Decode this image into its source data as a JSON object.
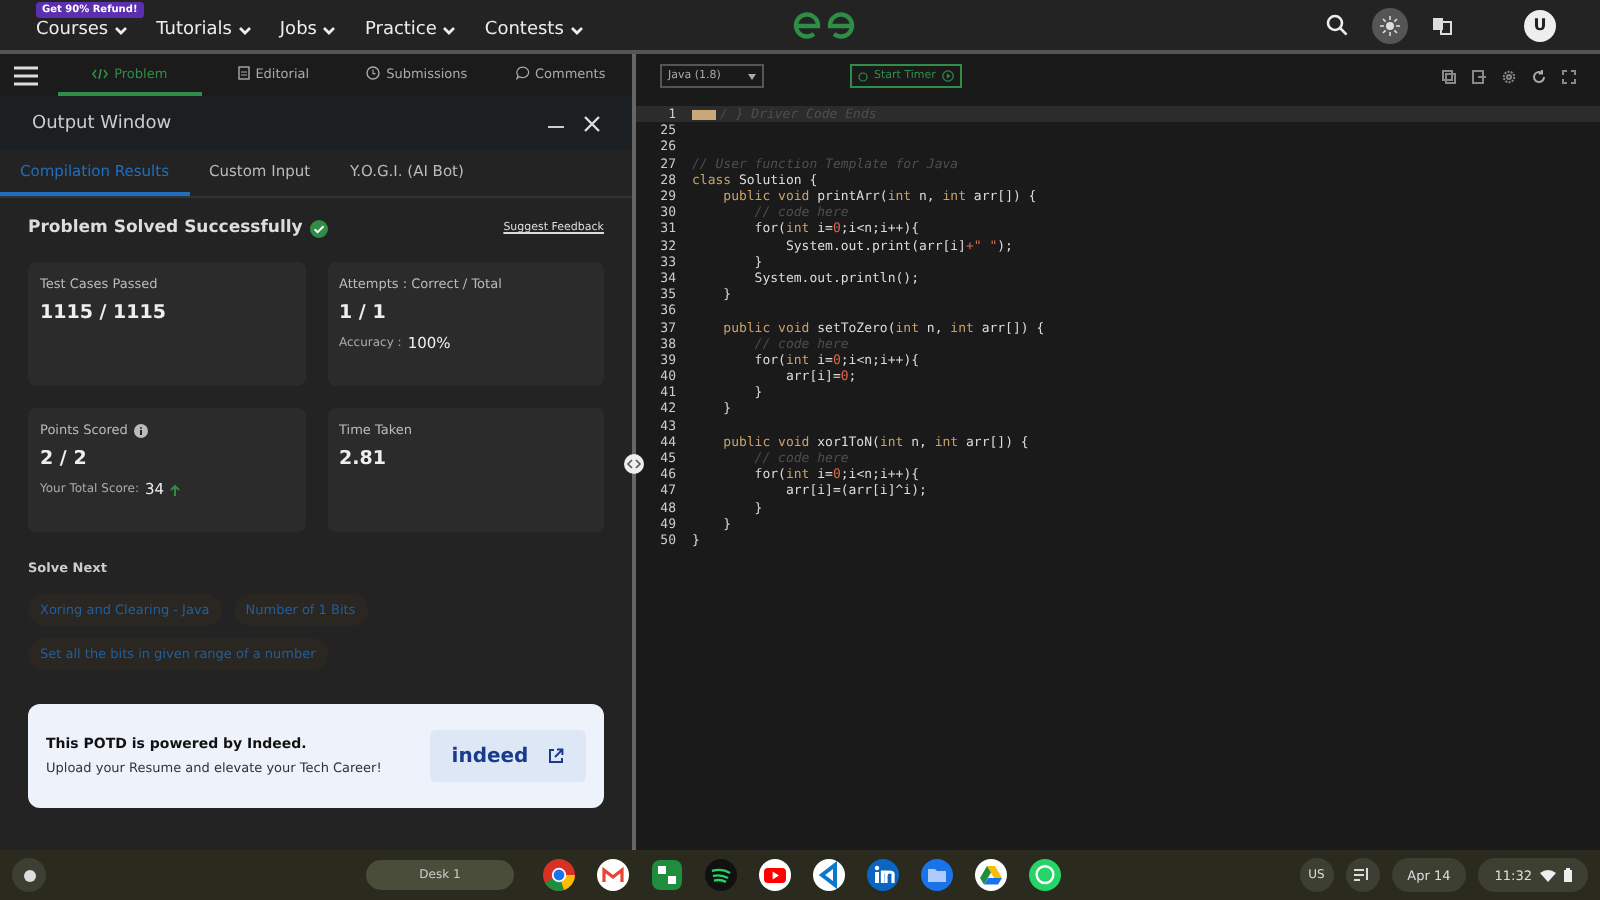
{
  "top_nav": {
    "promo_badge": "Get 90% Refund!",
    "menus": [
      "Courses",
      "Tutorials",
      "Jobs",
      "Practice",
      "Contests"
    ],
    "avatar": "U"
  },
  "problem_tabs": [
    {
      "label": "Problem",
      "selected": true
    },
    {
      "label": "Editorial",
      "selected": false
    },
    {
      "label": "Submissions",
      "selected": false
    },
    {
      "label": "Comments",
      "selected": false
    }
  ],
  "output_window": {
    "title": "Output Window",
    "tabs": [
      {
        "label": "Compilation Results",
        "selected": true
      },
      {
        "label": "Custom Input",
        "selected": false
      },
      {
        "label": "Y.O.G.I. (AI Bot)",
        "selected": false
      }
    ],
    "status": "Problem Solved Successfully",
    "feedback_link": "Suggest Feedback",
    "cards": [
      {
        "label": "Test Cases Passed",
        "value": "1115 / 1115"
      },
      {
        "label": "Attempts : Correct / Total",
        "value": "1 / 1",
        "sub_label": "Accuracy :",
        "sub_value": "100%"
      },
      {
        "label": "Points Scored",
        "value": "2 / 2",
        "info": true,
        "sub_label": "Your Total Score:",
        "sub_value": "34",
        "trend_up": true
      },
      {
        "label": "Time Taken",
        "value": "2.81"
      }
    ],
    "solve_next_title": "Solve Next",
    "solve_next": [
      "Xoring and Clearing - Java",
      "Number of 1 Bits",
      "Set all the bits in given range of a number"
    ],
    "promo": {
      "title": "This POTD is powered by Indeed.",
      "text": "Upload your Resume and elevate your Tech Career!",
      "logo": "indeed"
    }
  },
  "editor": {
    "language": "Java (1.8)",
    "timer": "Start Timer",
    "lines": [
      {
        "num": "1",
        "folded": true,
        "tokens": [
          {
            "kind": "cm",
            "text": "/ } Driver Code Ends"
          }
        ]
      },
      {
        "num": "25"
      },
      {
        "num": "26"
      },
      {
        "num": "27",
        "tokens": [
          {
            "kind": "cm",
            "text": "// User function Template for Java"
          }
        ]
      },
      {
        "num": "28",
        "tokens": [
          {
            "kind": "kw",
            "text": "class"
          },
          {
            "kind": "tx",
            "text": " Solution {"
          }
        ]
      },
      {
        "num": "29",
        "tokens": [
          {
            "kind": "kw",
            "text": "    public void"
          },
          {
            "kind": "tx",
            "text": " printArr("
          },
          {
            "kind": "kw",
            "text": "int"
          },
          {
            "kind": "tx",
            "text": " n, "
          },
          {
            "kind": "kw",
            "text": "int"
          },
          {
            "kind": "tx",
            "text": " arr[]) {"
          }
        ]
      },
      {
        "num": "30",
        "tokens": [
          {
            "kind": "cm",
            "text": "        // code here"
          }
        ]
      },
      {
        "num": "31",
        "tokens": [
          {
            "kind": "tx",
            "text": "        for("
          },
          {
            "kind": "kw",
            "text": "int"
          },
          {
            "kind": "tx",
            "text": " i="
          },
          {
            "kind": "nm",
            "text": "0"
          },
          {
            "kind": "tx",
            "text": ";i<n;i++){"
          }
        ]
      },
      {
        "num": "32",
        "tokens": [
          {
            "kind": "tx",
            "text": "            System.out.print(arr[i]"
          },
          {
            "kind": "nm",
            "text": "+\" \""
          },
          {
            "kind": "tx",
            "text": ");"
          }
        ]
      },
      {
        "num": "33",
        "tokens": [
          {
            "kind": "tx",
            "text": "        }"
          }
        ]
      },
      {
        "num": "34",
        "tokens": [
          {
            "kind": "tx",
            "text": "        System.out.println();"
          }
        ]
      },
      {
        "num": "35",
        "tokens": [
          {
            "kind": "tx",
            "text": "    }"
          }
        ]
      },
      {
        "num": "36"
      },
      {
        "num": "37",
        "tokens": [
          {
            "kind": "kw",
            "text": "    public void"
          },
          {
            "kind": "tx",
            "text": " setToZero("
          },
          {
            "kind": "kw",
            "text": "int"
          },
          {
            "kind": "tx",
            "text": " n, "
          },
          {
            "kind": "kw",
            "text": "int"
          },
          {
            "kind": "tx",
            "text": " arr[]) {"
          }
        ]
      },
      {
        "num": "38",
        "tokens": [
          {
            "kind": "cm",
            "text": "        // code here"
          }
        ]
      },
      {
        "num": "39",
        "tokens": [
          {
            "kind": "tx",
            "text": "        for("
          },
          {
            "kind": "kw",
            "text": "int"
          },
          {
            "kind": "tx",
            "text": " i="
          },
          {
            "kind": "nm",
            "text": "0"
          },
          {
            "kind": "tx",
            "text": ";i<n;i++){"
          }
        ]
      },
      {
        "num": "40",
        "tokens": [
          {
            "kind": "tx",
            "text": "            arr[i]="
          },
          {
            "kind": "nm",
            "text": "0"
          },
          {
            "kind": "tx",
            "text": ";"
          }
        ]
      },
      {
        "num": "41",
        "tokens": [
          {
            "kind": "tx",
            "text": "        }"
          }
        ]
      },
      {
        "num": "42",
        "tokens": [
          {
            "kind": "tx",
            "text": "    }"
          }
        ]
      },
      {
        "num": "43"
      },
      {
        "num": "44",
        "tokens": [
          {
            "kind": "kw",
            "text": "    public void"
          },
          {
            "kind": "tx",
            "text": " xor1ToN("
          },
          {
            "kind": "kw",
            "text": "int"
          },
          {
            "kind": "tx",
            "text": " n, "
          },
          {
            "kind": "kw",
            "text": "int"
          },
          {
            "kind": "tx",
            "text": " arr[]) {"
          }
        ]
      },
      {
        "num": "45",
        "tokens": [
          {
            "kind": "cm",
            "text": "        // code here"
          }
        ]
      },
      {
        "num": "46",
        "tokens": [
          {
            "kind": "tx",
            "text": "        for("
          },
          {
            "kind": "kw",
            "text": "int"
          },
          {
            "kind": "tx",
            "text": " i="
          },
          {
            "kind": "nm",
            "text": "0"
          },
          {
            "kind": "tx",
            "text": ";i<n;i++){"
          }
        ]
      },
      {
        "num": "47",
        "tokens": [
          {
            "kind": "tx",
            "text": "            arr[i]=(arr[i]^i);"
          }
        ]
      },
      {
        "num": "48",
        "tokens": [
          {
            "kind": "tx",
            "text": "        }"
          }
        ]
      },
      {
        "num": "49",
        "tokens": [
          {
            "kind": "tx",
            "text": "    }"
          }
        ]
      },
      {
        "num": "50",
        "tokens": [
          {
            "kind": "tx",
            "text": "}"
          }
        ]
      }
    ]
  },
  "taskbar": {
    "desk": "Desk 1",
    "apps": [
      {
        "kind": "browser"
      },
      {
        "kind": "mail"
      },
      {
        "kind": "sheets"
      },
      {
        "kind": "music"
      },
      {
        "kind": "video"
      },
      {
        "kind": "code"
      },
      {
        "kind": "in"
      },
      {
        "kind": "folder"
      },
      {
        "kind": "drive"
      },
      {
        "kind": "chat"
      }
    ],
    "keyboard": "US",
    "date": "Apr 14",
    "time": "11:32"
  }
}
